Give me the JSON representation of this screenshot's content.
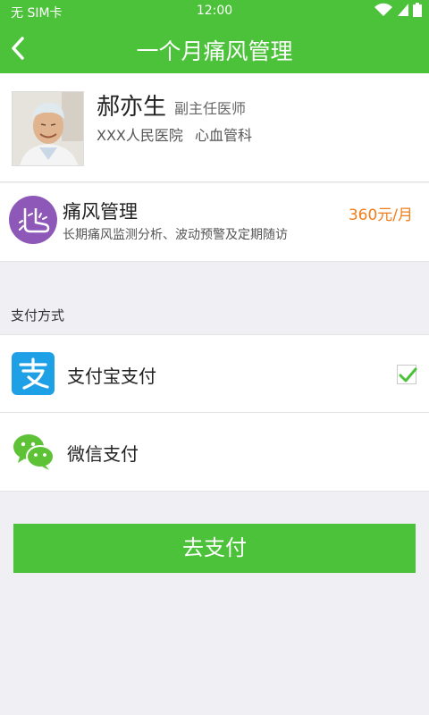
{
  "status_bar": {
    "carrier": "无  SIM卡",
    "time": "12:00",
    "icons": [
      "wifi-icon",
      "signal-icon",
      "battery-icon"
    ]
  },
  "navbar": {
    "back_icon": "chevron-left-icon",
    "title": "一个月痛风管理"
  },
  "doctor": {
    "name": "郝亦生",
    "title": "副主任医师",
    "hospital": "XXX人民医院",
    "department": "心血管科"
  },
  "service": {
    "icon": "foot-icon",
    "name": "痛风管理",
    "description": "长期痛风监测分析、波动预警及定期随访",
    "price": "360元/月"
  },
  "payment": {
    "section_label": "支付方式",
    "methods": [
      {
        "label": "支付宝支付",
        "icon": "alipay-icon",
        "selected": true
      },
      {
        "label": "微信支付",
        "icon": "wechat-icon",
        "selected": false
      }
    ]
  },
  "pay_button": {
    "label": "去支付"
  },
  "colors": {
    "primary_green": "#4cc23a",
    "price_orange": "#f07d1a",
    "service_purple": "#8e58b8",
    "alipay_blue": "#1ea0e6",
    "wechat_green": "#5ec236",
    "background": "#efeff4"
  }
}
